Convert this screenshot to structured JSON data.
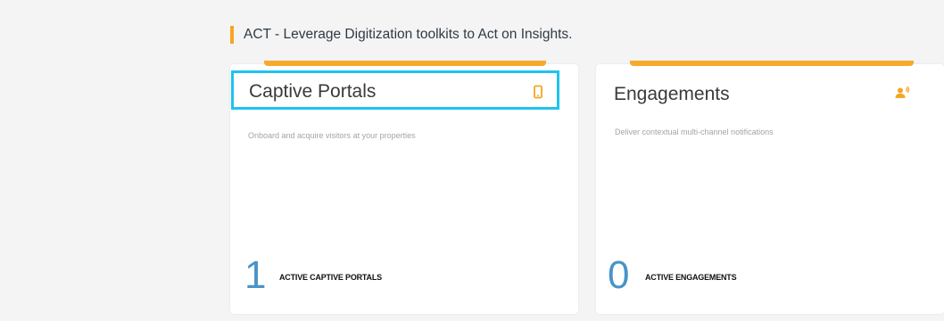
{
  "section": {
    "title": "ACT - Leverage Digitization toolkits to Act on Insights."
  },
  "cards": [
    {
      "title": "Captive Portals",
      "icon": "mobile-phone-icon",
      "description": "Onboard and acquire visitors at your properties",
      "count": "1",
      "count_label": "ACTIVE CAPTIVE PORTALS"
    },
    {
      "title": "Engagements",
      "icon": "user-notification-icon",
      "description": "Deliver contextual multi-channel notifications",
      "count": "0",
      "count_label": "ACTIVE ENGAGEMENTS"
    }
  ],
  "colors": {
    "accent": "#f7a92c",
    "highlight": "#1ec3ef",
    "count": "#4a93c9",
    "background": "#f4f4f4"
  }
}
